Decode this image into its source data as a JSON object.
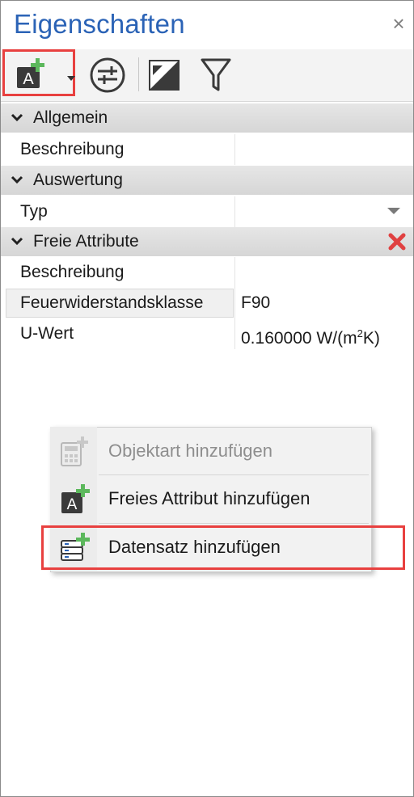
{
  "panel": {
    "title": "Eigenschaften",
    "close_glyph": "×"
  },
  "toolbar": {
    "add_attribute_icon": "add-attribute-icon",
    "properties_icon": "sliders-icon",
    "contrast_icon": "contrast-icon",
    "filter_icon": "filter-icon"
  },
  "sections": {
    "allgemein": {
      "label": "Allgemein",
      "rows": [
        {
          "key": "Beschreibung",
          "value": ""
        }
      ]
    },
    "auswertung": {
      "label": "Auswertung",
      "rows": [
        {
          "key": "Typ",
          "value": ""
        }
      ]
    },
    "freie_attribute": {
      "label": "Freie Attribute",
      "rows": [
        {
          "key": "Beschreibung",
          "value": ""
        },
        {
          "key": "Feuerwiderstandsklasse",
          "value": "F90"
        },
        {
          "key": "U-Wert",
          "value_prefix": "0.160000 W/(m",
          "value_sup": "2",
          "value_suffix": "K)"
        }
      ]
    }
  },
  "context_menu": {
    "items": [
      {
        "label": "Objektart hinzufügen",
        "enabled": false,
        "icon": "calculator-add-icon"
      },
      {
        "label": "Freies Attribut hinzufügen",
        "enabled": true,
        "icon": "add-attribute-icon"
      },
      {
        "label": "Datensatz hinzufügen",
        "enabled": true,
        "icon": "database-add-icon"
      }
    ]
  },
  "colors": {
    "title": "#2b63b6",
    "highlight": "#e8403f",
    "add_green": "#5cb85c",
    "delete_red": "#e04040"
  }
}
